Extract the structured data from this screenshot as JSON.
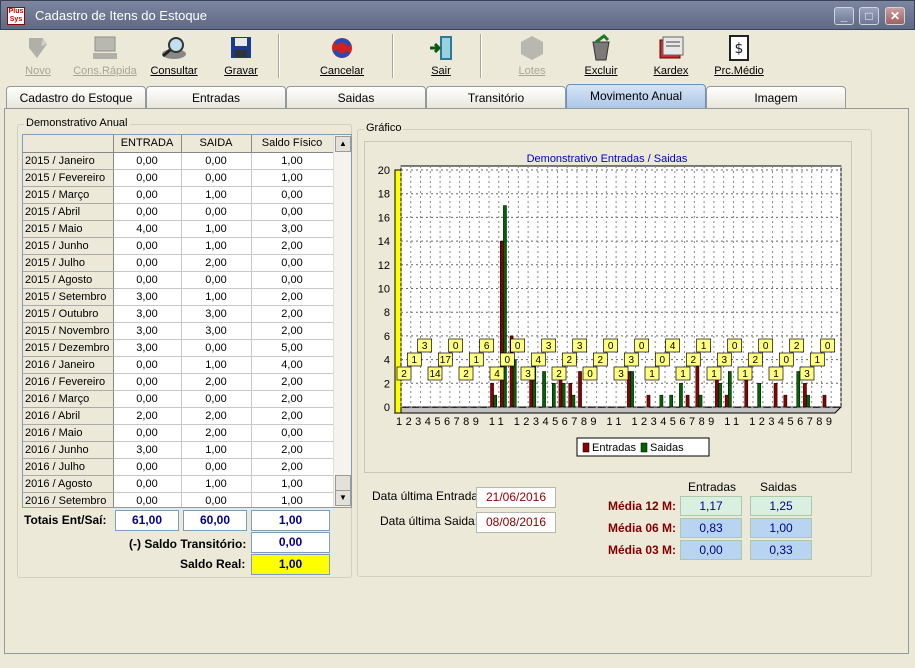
{
  "window": {
    "title": "Cadastro de Itens do Estoque",
    "app_icon": "Plus Sys"
  },
  "toolbar": [
    {
      "label": "Novo",
      "icon": "new-icon",
      "enabled": false
    },
    {
      "label": "Cons.Rápida",
      "icon": "computer-icon",
      "enabled": false
    },
    {
      "label": "Consultar",
      "icon": "magnifier-icon",
      "enabled": true
    },
    {
      "label": "Gravar",
      "icon": "floppy-icon",
      "enabled": true
    },
    {
      "label": "Cancelar",
      "icon": "cancel-icon",
      "enabled": true
    },
    {
      "label": "Sair",
      "icon": "exit-door-icon",
      "enabled": true
    },
    {
      "label": "Lotes",
      "icon": "lots-icon",
      "enabled": false
    },
    {
      "label": "Excluir",
      "icon": "trash-icon",
      "enabled": true
    },
    {
      "label": "Kardex",
      "icon": "kardex-icon",
      "enabled": true
    },
    {
      "label": "Prc.Médio",
      "icon": "price-icon",
      "enabled": true
    }
  ],
  "tabs": [
    "Cadastro do Estoque",
    "Entradas",
    "Saidas",
    "Transitório",
    "Movimento Anual",
    "Imagem"
  ],
  "active_tab": "Movimento Anual",
  "demonstrativo": {
    "group_title": "Demonstrativo Anual",
    "columns": [
      "ENTRADA",
      "SAIDA",
      "Saldo Físico"
    ],
    "rows": [
      {
        "label": "2015 / Janeiro",
        "entrada": "0,00",
        "saida": "0,00",
        "saldo": "1,00"
      },
      {
        "label": "2015 / Fevereiro",
        "entrada": "0,00",
        "saida": "0,00",
        "saldo": "1,00"
      },
      {
        "label": "2015 / Março",
        "entrada": "0,00",
        "saida": "1,00",
        "saldo": "0,00"
      },
      {
        "label": "2015 / Abril",
        "entrada": "0,00",
        "saida": "0,00",
        "saldo": "0,00"
      },
      {
        "label": "2015 / Maio",
        "entrada": "4,00",
        "saida": "1,00",
        "saldo": "3,00"
      },
      {
        "label": "2015 / Junho",
        "entrada": "0,00",
        "saida": "1,00",
        "saldo": "2,00"
      },
      {
        "label": "2015 / Julho",
        "entrada": "0,00",
        "saida": "2,00",
        "saldo": "0,00"
      },
      {
        "label": "2015 / Agosto",
        "entrada": "0,00",
        "saida": "0,00",
        "saldo": "0,00"
      },
      {
        "label": "2015 / Setembro",
        "entrada": "3,00",
        "saida": "1,00",
        "saldo": "2,00"
      },
      {
        "label": "2015 / Outubro",
        "entrada": "3,00",
        "saida": "3,00",
        "saldo": "2,00"
      },
      {
        "label": "2015 / Novembro",
        "entrada": "3,00",
        "saida": "3,00",
        "saldo": "2,00"
      },
      {
        "label": "2015 / Dezembro",
        "entrada": "3,00",
        "saida": "0,00",
        "saldo": "5,00"
      },
      {
        "label": "2016 / Janeiro",
        "entrada": "0,00",
        "saida": "1,00",
        "saldo": "4,00"
      },
      {
        "label": "2016 / Fevereiro",
        "entrada": "0,00",
        "saida": "2,00",
        "saldo": "2,00"
      },
      {
        "label": "2016 / Março",
        "entrada": "0,00",
        "saida": "0,00",
        "saldo": "2,00"
      },
      {
        "label": "2016 / Abril",
        "entrada": "2,00",
        "saida": "2,00",
        "saldo": "2,00"
      },
      {
        "label": "2016 / Maio",
        "entrada": "0,00",
        "saida": "2,00",
        "saldo": "0,00"
      },
      {
        "label": "2016 / Junho",
        "entrada": "3,00",
        "saida": "1,00",
        "saldo": "2,00"
      },
      {
        "label": "2016 / Julho",
        "entrada": "0,00",
        "saida": "0,00",
        "saldo": "2,00"
      },
      {
        "label": "2016 / Agosto",
        "entrada": "0,00",
        "saida": "1,00",
        "saldo": "1,00"
      },
      {
        "label": "2016 / Setembro",
        "entrada": "0,00",
        "saida": "0,00",
        "saldo": "1,00"
      }
    ],
    "totais_label": "Totais Ent/Saí:",
    "total_entrada": "61,00",
    "total_saida": "60,00",
    "total_saldo": "1,00",
    "saldo_transitorio_label": "(-) Saldo Transitório:",
    "saldo_transitorio": "0,00",
    "saldo_real_label": "Saldo Real:",
    "saldo_real": "1,00"
  },
  "grafico": {
    "group_title": "Gráfico",
    "highlight_color": "#ffff00"
  },
  "chart_data": {
    "type": "bar",
    "title": "Demonstrativo Entradas / Saidas",
    "ylim": [
      0,
      20
    ],
    "yticks": [
      "0",
      "2",
      "4",
      "6",
      "8",
      "10",
      "12",
      "14",
      "16",
      "18",
      "20"
    ],
    "x_tick_text": "123456789 11 123456789 11 123456789 11 123456789",
    "legend": [
      "Entradas",
      "Saidas"
    ],
    "legend_position": "bottom",
    "colors": {
      "Entradas": "#8b0000",
      "Saidas": "#006400"
    },
    "categories": [
      "1",
      "2",
      "3",
      "4",
      "5",
      "6",
      "7",
      "8",
      "9",
      "10",
      "11",
      "12",
      "1",
      "2",
      "3",
      "4",
      "5",
      "6",
      "7",
      "8",
      "9",
      "10",
      "11",
      "12",
      "1",
      "2",
      "3",
      "4",
      "5",
      "6",
      "7",
      "8",
      "9",
      "10",
      "11",
      "12",
      "1",
      "2",
      "3",
      "4",
      "5",
      "6",
      "7",
      "8",
      "9"
    ],
    "series": [
      {
        "name": "Entradas",
        "values": [
          0,
          0,
          0,
          0,
          0,
          0,
          0,
          0,
          0,
          2,
          14,
          6,
          0,
          3,
          0,
          0,
          3,
          2,
          3,
          0,
          0,
          0,
          0,
          3,
          0,
          1,
          0,
          0,
          0,
          1,
          4,
          0,
          3,
          1,
          0,
          3,
          0,
          0,
          2,
          1,
          0,
          2,
          0,
          1,
          0
        ]
      },
      {
        "name": "Saidas",
        "values": [
          0,
          0,
          0,
          0,
          0,
          0,
          0,
          0,
          0,
          1,
          17,
          4,
          0,
          4,
          3,
          2,
          2,
          1,
          0,
          0,
          0,
          0,
          0,
          3,
          0,
          0,
          1,
          1,
          2,
          0,
          1,
          0,
          2,
          3,
          0,
          0,
          2,
          0,
          0,
          0,
          3,
          1,
          0,
          0,
          0
        ]
      }
    ],
    "data_labels": [
      "2",
      "1",
      "3",
      "14",
      "17",
      "0",
      "2",
      "1",
      "6",
      "4",
      "0",
      "0",
      "3",
      "4",
      "3",
      "2",
      "2",
      "3",
      "0",
      "2",
      "0",
      "3",
      "3",
      "0",
      "1",
      "0",
      "4",
      "1",
      "2",
      "1",
      "1",
      "3",
      "0",
      "1",
      "2",
      "0",
      "1",
      "0",
      "2",
      "3",
      "1",
      "0"
    ]
  },
  "datas": {
    "entrada_label": "Data última Entrada:",
    "entrada_value": "21/06/2016",
    "saida_label": "Data última Saida:",
    "saida_value": "08/08/2016"
  },
  "medias": {
    "col_entradas": "Entradas",
    "col_saidas": "Saidas",
    "rows": [
      {
        "label": "Média 12 M:",
        "entradas": "1,17",
        "saidas": "1,25",
        "color": "#d9f0e0"
      },
      {
        "label": "Média 06 M:",
        "entradas": "0,83",
        "saidas": "1,00",
        "color": "#b8d4f0"
      },
      {
        "label": "Média 03 M:",
        "entradas": "0,00",
        "saidas": "0,33",
        "color": "#b8d4f0"
      }
    ]
  }
}
